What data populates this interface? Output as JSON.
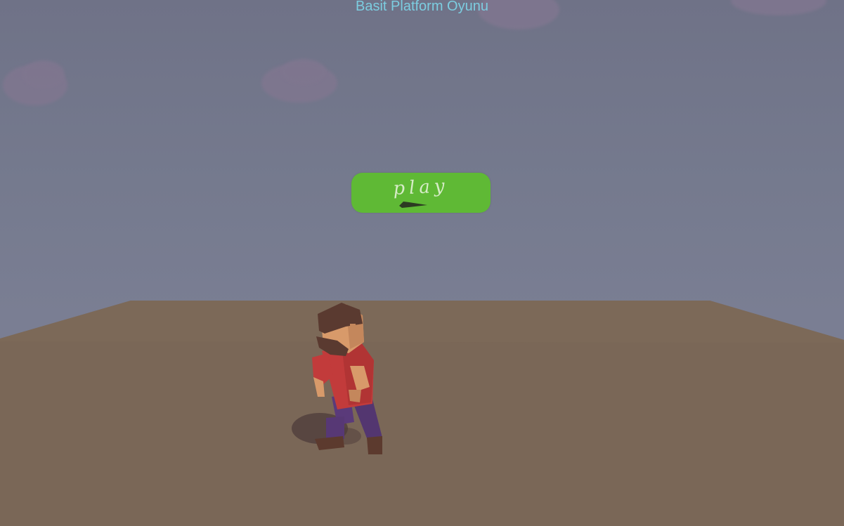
{
  "window": {
    "title": "Basit Platform Oyunu"
  },
  "menu": {
    "play_button_label": "play",
    "play_button_icon": "play-arrow-icon"
  },
  "colors": {
    "sky": "#767a8d",
    "ground": "#7a6757",
    "clouds": "#7f768f",
    "title_text": "#7ccde0",
    "play_button": "#5fb935",
    "shirt": "#c23b3b",
    "pants": "#5a3a7a",
    "skin": "#d89a6a",
    "hair": "#5a3a30"
  }
}
